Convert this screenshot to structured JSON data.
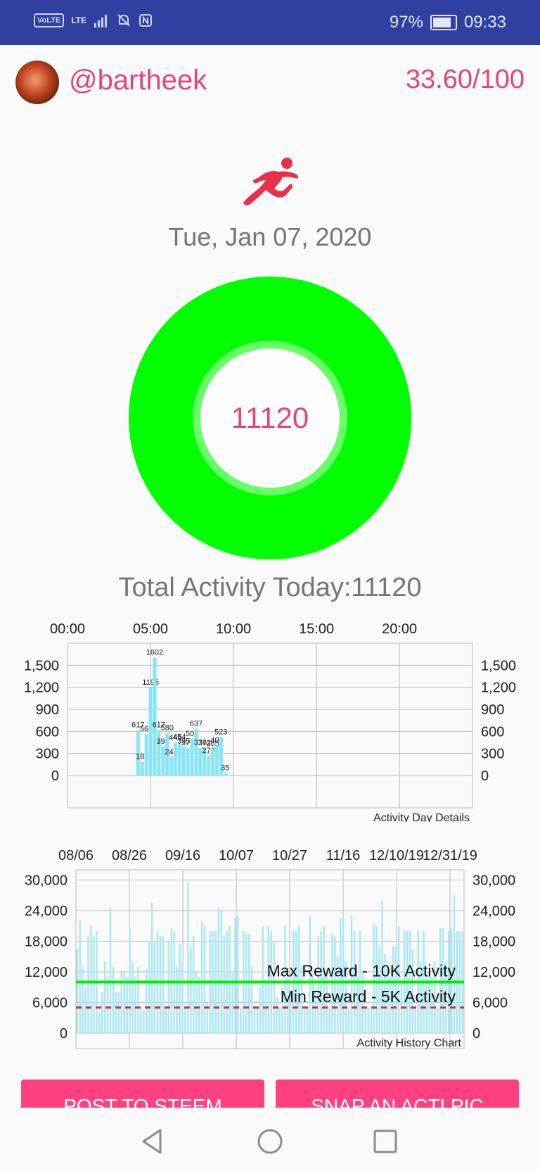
{
  "status_bar": {
    "volte": "VoLTE",
    "network": "LTE",
    "battery_percent": "97%",
    "battery_level": 0.97,
    "time": "09:33"
  },
  "profile": {
    "username": "@bartheek",
    "score": "33.60/100"
  },
  "date": "Tue, Jan 07, 2020",
  "ring": {
    "value": "11120"
  },
  "total_activity": "Total Activity Today:11120",
  "day_chart": {
    "type": "bar",
    "x_ticks": [
      "00:00",
      "05:00",
      "10:00",
      "15:00",
      "20:00"
    ],
    "x_range": [
      0,
      24
    ],
    "y_ticks": [
      "0",
      "300",
      "600",
      "900",
      "1,200",
      "1,500"
    ],
    "ylim": [
      0,
      1800
    ],
    "legend": "Activity Day Details",
    "bars": [
      {
        "t": 4.25,
        "v": 617,
        "label": "617"
      },
      {
        "t": 4.5,
        "v": 185,
        "label": "185"
      },
      {
        "t": 4.75,
        "v": 563,
        "label": "563"
      },
      {
        "t": 5.0,
        "v": 1195,
        "label": "1195"
      },
      {
        "t": 5.25,
        "v": 1602,
        "label": "1602"
      },
      {
        "t": 5.5,
        "v": 617,
        "label": "617"
      },
      {
        "t": 5.75,
        "v": 394,
        "label": "394"
      },
      {
        "t": 6.0,
        "v": 580,
        "label": "580"
      },
      {
        "t": 6.25,
        "v": 249,
        "label": "249"
      },
      {
        "t": 6.5,
        "v": 445,
        "label": "445"
      },
      {
        "t": 6.75,
        "v": 454,
        "label": "454"
      },
      {
        "t": 7.0,
        "v": 395,
        "label": "395"
      },
      {
        "t": 7.25,
        "v": 372,
        "label": "372"
      },
      {
        "t": 7.5,
        "v": 500,
        "label": "500"
      },
      {
        "t": 7.75,
        "v": 637,
        "label": "637"
      },
      {
        "t": 8.0,
        "v": 376,
        "label": "376"
      },
      {
        "t": 8.25,
        "v": 372,
        "label": "372"
      },
      {
        "t": 8.5,
        "v": 270,
        "label": "270"
      },
      {
        "t": 8.75,
        "v": 365,
        "label": "365"
      },
      {
        "t": 9.0,
        "v": 409,
        "label": "409"
      },
      {
        "t": 9.25,
        "v": 523,
        "label": "523"
      },
      {
        "t": 9.5,
        "v": 35,
        "label": "35"
      }
    ]
  },
  "history_chart": {
    "type": "bar",
    "x_ticks": [
      "08/06",
      "08/26",
      "09/16",
      "10/07",
      "10/27",
      "11/16",
      "12/10/19",
      "12/31/19"
    ],
    "y_ticks": [
      "0",
      "6,000",
      "12,000",
      "18,000",
      "24,000",
      "30,000"
    ],
    "ylim": [
      0,
      32000
    ],
    "legend": "Activity History Chart",
    "max_line": {
      "value": 10000,
      "label": "Max Reward - 10K Activity",
      "color": "#00ee00"
    },
    "min_line": {
      "value": 5000,
      "label": "Min Reward - 5K Activity",
      "color": "#d32f2f"
    },
    "values": [
      16500,
      22000,
      13000,
      9000,
      19000,
      21000,
      19000,
      20000,
      4000,
      8000,
      14000,
      11000,
      24500,
      13000,
      8000,
      8000,
      12000,
      12000,
      11000,
      20500,
      14000,
      11000,
      13000,
      5000,
      4500,
      12500,
      18000,
      25500,
      18000,
      20000,
      19000,
      19000,
      5000,
      18000,
      20500,
      20000,
      13000,
      17500,
      14000,
      5000,
      29500,
      17000,
      19000,
      12000,
      11000,
      22000,
      21000,
      6000,
      20000,
      20000,
      20000,
      24500,
      24000,
      19000,
      20000,
      21000,
      12000,
      22500,
      23000,
      5000,
      20000,
      19500,
      19500,
      13000,
      5000,
      5000,
      9000,
      21000,
      10000,
      21000,
      20000,
      18000,
      7000,
      5000,
      9000,
      21000,
      11000,
      8000,
      20000,
      20000,
      21000,
      13000,
      5000,
      5000,
      23000,
      11000,
      9000,
      19000,
      20000,
      21000,
      12000,
      5000,
      19500,
      19000,
      15000,
      22500,
      22500,
      14000,
      5000,
      23000,
      20000,
      11000,
      20000,
      12000,
      5000,
      5000,
      5000,
      21500,
      21000,
      17000,
      26000,
      15500,
      13000,
      11000,
      17000,
      17000,
      21000,
      10000,
      20000,
      20000,
      20000,
      16500,
      5000,
      20000,
      14000,
      20000,
      12000,
      12000,
      11000,
      14000,
      5000,
      20500,
      20500,
      14000,
      20000,
      20500,
      27000,
      20000,
      20000,
      20000
    ]
  },
  "buttons": {
    "post": "POST TO STEEM",
    "snap": "SNAP AN ACTI PIC"
  }
}
